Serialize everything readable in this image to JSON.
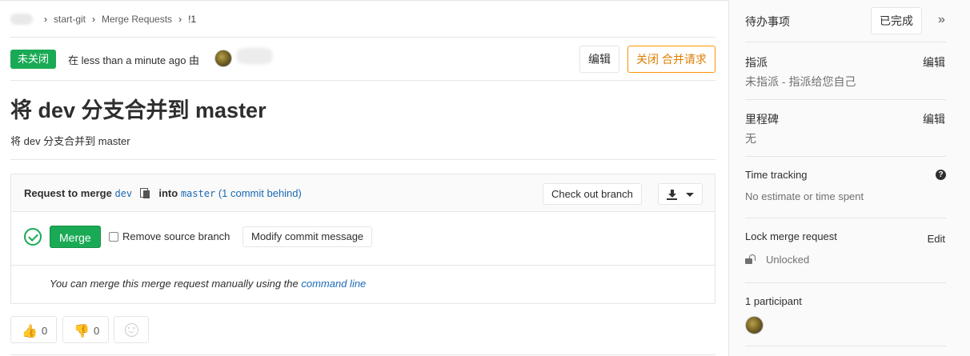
{
  "breadcrumb": {
    "project": "start-git",
    "section": "Merge Requests",
    "current": "!1",
    "separator": "›"
  },
  "status": {
    "badge": "未关闭",
    "text": "在 less than a minute ago 由"
  },
  "actions": {
    "edit_label": "编辑",
    "close_label": "关闭 合并请求"
  },
  "issue": {
    "title": "将 dev 分支合并到 master",
    "description": "将 dev 分支合并到 master"
  },
  "merge_widget": {
    "request_prefix": "Request to merge",
    "source_branch": "dev",
    "into_label": "into",
    "target_branch": "master",
    "behind_text": "(1 commit behind)",
    "checkout_label": "Check out branch",
    "merge_label": "Merge",
    "remove_source_label": "Remove source branch",
    "modify_commit_label": "Modify commit message",
    "manual_text": "You can merge this merge request manually using the",
    "command_line_label": "command line"
  },
  "emoji": {
    "thumbs_up_count": "0",
    "thumbs_down_count": "0"
  },
  "sidebar": {
    "todo_label": "待办事项",
    "done_label": "已完成",
    "collapse_glyph": "»",
    "assignee": {
      "label": "指派",
      "edit": "编辑",
      "value": "未指派 - 指派给您自己"
    },
    "milestone": {
      "label": "里程碑",
      "edit": "编辑",
      "value": "无"
    },
    "time_tracking": {
      "label": "Time tracking",
      "help": "?",
      "value": "No estimate or time spent"
    },
    "lock": {
      "label": "Lock merge request",
      "edit": "Edit",
      "value": "Unlocked"
    },
    "participants": {
      "label": "1 participant"
    }
  },
  "colors": {
    "success_green": "#1aaa55",
    "link_blue": "#1b69b6",
    "warning_orange": "#fc9403"
  }
}
